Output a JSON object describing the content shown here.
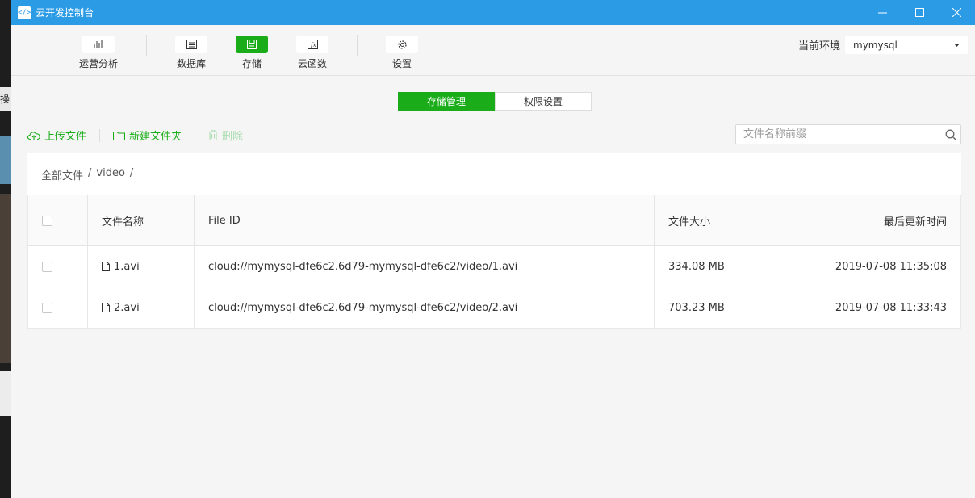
{
  "window": {
    "title": "云开发控制台",
    "icon_glyph": "</>"
  },
  "toolbar": {
    "items": [
      {
        "label": "运营分析",
        "icon": "chart-icon"
      },
      {
        "label": "数据库",
        "icon": "database-icon"
      },
      {
        "label": "存储",
        "icon": "save-icon",
        "active": true
      },
      {
        "label": "云函数",
        "icon": "function-icon"
      },
      {
        "label": "设置",
        "icon": "gear-icon"
      }
    ],
    "env_label": "当前环境",
    "env_value": "mymysql"
  },
  "tabs": {
    "storage": "存储管理",
    "permissions": "权限设置"
  },
  "actions": {
    "upload": "上传文件",
    "new_folder": "新建文件夹",
    "delete": "删除"
  },
  "search": {
    "placeholder": "文件名称前缀"
  },
  "breadcrumb": {
    "root": "全部文件",
    "sep": "/",
    "folder": "video",
    "sep2": "/"
  },
  "table": {
    "headers": {
      "name": "文件名称",
      "file_id": "File ID",
      "size": "文件大小",
      "updated": "最后更新时间"
    },
    "rows": [
      {
        "name": "1.avi",
        "file_id": "cloud://mymysql-dfe6c2.6d79-mymysql-dfe6c2/video/1.avi",
        "size": "334.08 MB",
        "updated": "2019-07-08 11:35:08"
      },
      {
        "name": "2.avi",
        "file_id": "cloud://mymysql-dfe6c2.6d79-mymysql-dfe6c2/video/2.avi",
        "size": "703.23 MB",
        "updated": "2019-07-08 11:33:43"
      }
    ]
  },
  "desktop": {
    "partial_text": "操"
  },
  "colors": {
    "titlebar": "#2b9be6",
    "accent": "#1aad19"
  }
}
